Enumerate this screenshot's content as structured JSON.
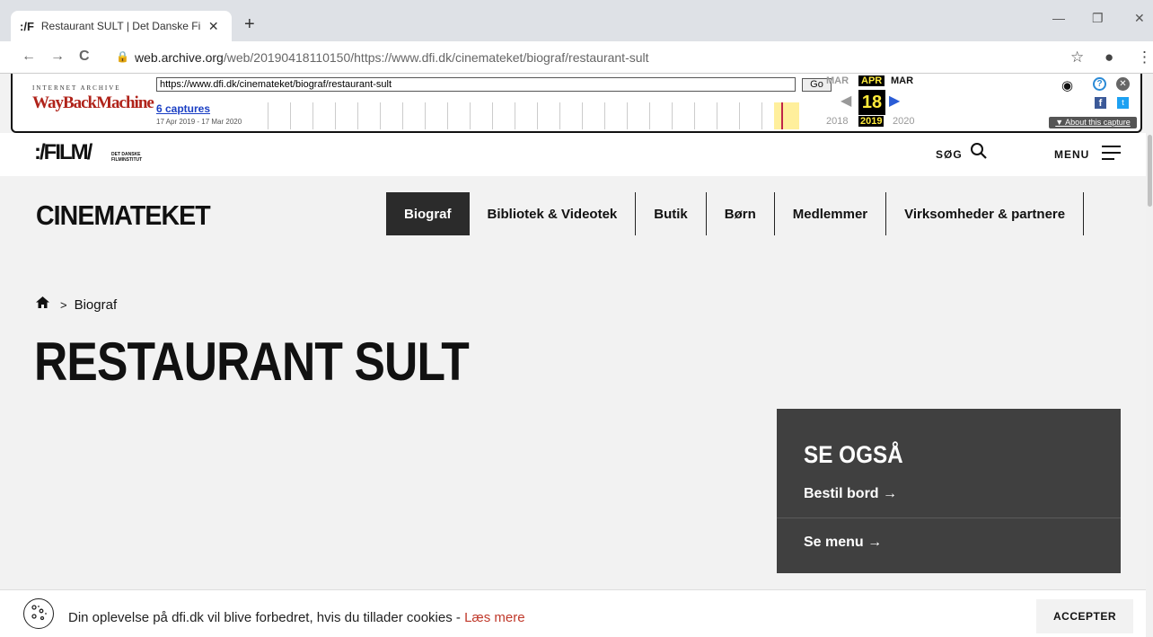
{
  "browser": {
    "tab_title": "Restaurant SULT | Det Danske Filr",
    "tab_favicon": ":/F",
    "new_tab": "+",
    "tab_close": "✕",
    "win_min": "—",
    "win_restore": "❐",
    "win_close": "✕",
    "back": "←",
    "forward": "→",
    "reload": "C",
    "url_host": "web.archive.org",
    "url_path": "/web/20190418110150/https://www.dfi.dk/cinemateket/biograf/restaurant-sult",
    "bookmark": "☆",
    "profile": "●",
    "menu_dots": "⋮"
  },
  "wayback": {
    "logo_top": "INTERNET ARCHIVE",
    "logo": "WayBackMachine",
    "url_input": "https://www.dfi.dk/cinemateket/biograf/restaurant-sult",
    "go": "Go",
    "captures": "6 captures",
    "range": "17 Apr 2019 - 17 Mar 2020",
    "month_prev": "MAR",
    "month_cur": "APR",
    "month_next": "MAR",
    "day": "18",
    "year_prev": "2018",
    "year_cur": "2019",
    "year_next": "2020",
    "about": "▼ About this capture"
  },
  "site": {
    "logo": ":/FILM/",
    "logo_sub": "DET DANSKE FILMINSTITUT",
    "search_label": "SØG",
    "menu_label": "MENU"
  },
  "cinemateket": {
    "title": "CINEMATEKET",
    "nav": [
      {
        "label": "Biograf"
      },
      {
        "label": "Bibliotek & Videotek"
      },
      {
        "label": "Butik"
      },
      {
        "label": "Børn"
      },
      {
        "label": "Medlemmer"
      },
      {
        "label": "Virksomheder & partnere"
      }
    ]
  },
  "breadcrumb": {
    "sep": ">",
    "current": "Biograf"
  },
  "page": {
    "title": "RESTAURANT SULT"
  },
  "see_also": {
    "title": "SE OGSÅ",
    "links": [
      {
        "label": "Bestil bord →"
      },
      {
        "label": "Se menu →"
      }
    ]
  },
  "cookie": {
    "text": "Din oplevelse på dfi.dk vil blive forbedret, hvis du tillader cookies - ",
    "link": "Læs mere",
    "accept": "ACCEPTER"
  },
  "colors": {
    "accent_dark": "#2b2b2b",
    "see_also_bg": "#404040",
    "cookie_link": "#c0392b",
    "wayback_red": "#b0231a"
  }
}
